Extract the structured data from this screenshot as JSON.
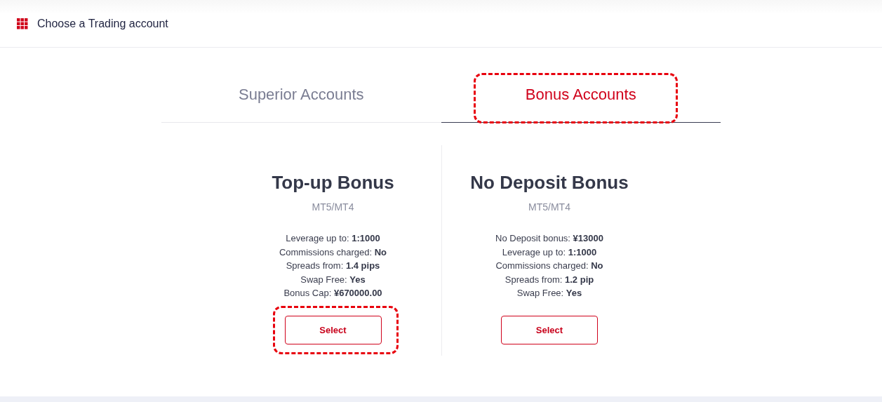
{
  "header": {
    "title": "Choose a Trading account"
  },
  "tabs": [
    {
      "label": "Superior Accounts",
      "selected": false,
      "highlighted": false
    },
    {
      "label": "Bonus Accounts",
      "selected": true,
      "highlighted": true
    }
  ],
  "cards": [
    {
      "title": "Top-up Bonus",
      "platform": "MT5/MT4",
      "features": [
        {
          "label": "Leverage up to:",
          "value": "1:1000"
        },
        {
          "label": "Commissions charged:",
          "value": "No"
        },
        {
          "label": "Spreads from:",
          "value": "1.4 pips"
        },
        {
          "label": "Swap Free:",
          "value": "Yes"
        },
        {
          "label": "Bonus Cap:",
          "value": "¥670000.00"
        }
      ],
      "button": "Select",
      "highlighted": true
    },
    {
      "title": "No Deposit Bonus",
      "platform": "MT5/MT4",
      "features": [
        {
          "label": "No Deposit bonus:",
          "value": "¥13000"
        },
        {
          "label": "Leverage up to:",
          "value": "1:1000"
        },
        {
          "label": "Commissions charged:",
          "value": "No"
        },
        {
          "label": "Spreads from:",
          "value": "1.2 pip"
        },
        {
          "label": "Swap Free:",
          "value": "Yes"
        }
      ],
      "button": "Select",
      "highlighted": false
    }
  ]
}
